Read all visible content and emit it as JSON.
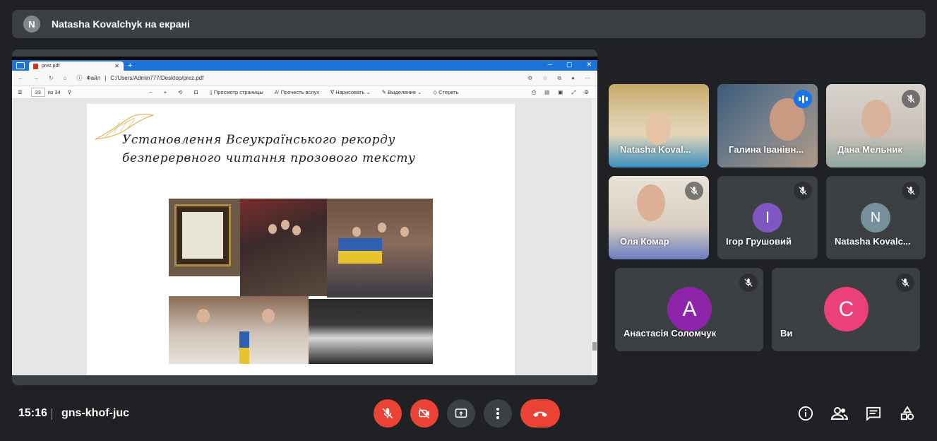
{
  "banner": {
    "avatar_letter": "N",
    "text": "Natasha Kovalchyk на екрані"
  },
  "shared_screen": {
    "browser": {
      "tab_title": "prez.pdf",
      "address_prefix": "Файл",
      "address": "C:/Users/Admin777/Desktop/prez.pdf"
    },
    "pdf_toolbar": {
      "page_current": "33",
      "page_total": "из 34",
      "view_label": "Просмотр страницы",
      "read_aloud_label": "Прочесть вслух",
      "draw_label": "Нарисовать",
      "highlight_label": "Выделение",
      "erase_label": "Стереть"
    },
    "slide": {
      "title_line1": "Установлення Всеукраїнського рекорду",
      "title_line2": "безперервного читання прозового тексту"
    }
  },
  "participants": [
    {
      "name": "Natasha Koval...",
      "muted": false,
      "speaking": false
    },
    {
      "name": "Галина Іванівн...",
      "muted": false,
      "speaking": true
    },
    {
      "name": "Дана Мельник",
      "muted": true,
      "speaking": false
    },
    {
      "name": "Оля Комар",
      "muted": true,
      "speaking": false
    },
    {
      "name": "Ігор Грушовий",
      "avatar_letter": "I",
      "avatar_color": "#7e57c2",
      "muted": true
    },
    {
      "name": "Natasha Kovalc...",
      "avatar_letter": "N",
      "avatar_color": "#78909c",
      "muted": true
    },
    {
      "name": "Анастасія Соломчук",
      "avatar_letter": "A",
      "avatar_color": "#8e24aa",
      "muted": true
    },
    {
      "name": "Ви",
      "avatar_letter": "C",
      "avatar_color": "#ec407a",
      "muted": true
    }
  ],
  "bottom_bar": {
    "time": "15:16",
    "meeting_code": "gns-khof-juc"
  },
  "colors": {
    "end_call": "#ea4335",
    "speaking_outline": "#8ab4f8",
    "background": "#202124"
  }
}
